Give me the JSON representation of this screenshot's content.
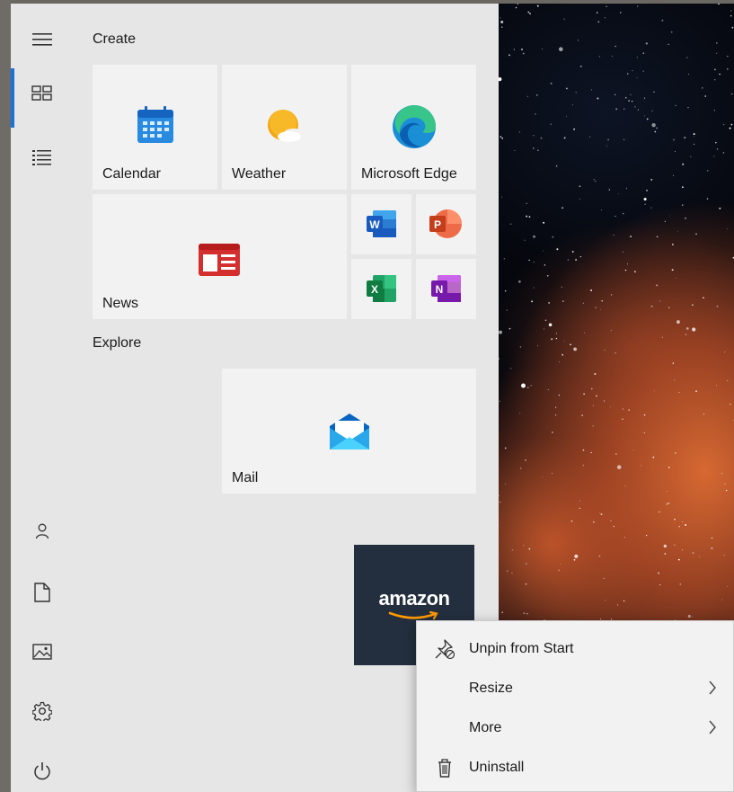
{
  "start_menu": {
    "rail": {
      "items": [
        {
          "icon": "hamburger-menu-icon"
        },
        {
          "icon": "tiles-icon",
          "active": true
        },
        {
          "icon": "all-apps-list-icon"
        },
        {
          "icon": "user-icon"
        },
        {
          "icon": "documents-icon"
        },
        {
          "icon": "pictures-icon"
        },
        {
          "icon": "settings-gear-icon"
        },
        {
          "icon": "power-icon"
        }
      ]
    },
    "groups": [
      {
        "title": "Create"
      },
      {
        "title": "Explore"
      }
    ],
    "tiles": {
      "calendar": {
        "label": "Calendar",
        "icon": "calendar-icon"
      },
      "weather": {
        "label": "Weather",
        "icon": "weather-icon"
      },
      "edge": {
        "label": "Microsoft Edge",
        "icon": "edge-icon"
      },
      "news": {
        "label": "News",
        "icon": "news-icon"
      },
      "word": {
        "letter": "W",
        "icon": "word-icon"
      },
      "powerpoint": {
        "letter": "P",
        "icon": "powerpoint-icon"
      },
      "excel": {
        "letter": "X",
        "icon": "excel-icon"
      },
      "onenote": {
        "letter": "N",
        "icon": "onenote-icon"
      },
      "mail": {
        "label": "Mail",
        "icon": "mail-icon"
      },
      "amazon": {
        "label": "amazon",
        "icon": "amazon-logo"
      }
    }
  },
  "context_menu": {
    "items": [
      {
        "label": "Unpin from Start",
        "icon": "unpin-icon",
        "submenu": false
      },
      {
        "label": "Resize",
        "icon": "",
        "submenu": true
      },
      {
        "label": "More",
        "icon": "",
        "submenu": true
      },
      {
        "label": "Uninstall",
        "icon": "trash-icon",
        "submenu": false
      }
    ]
  },
  "colors": {
    "accent": "#1a73d9",
    "start_bg": "#e6e6e6",
    "tile_bg": "#f2f2f2",
    "amazon_tile_bg": "#232f3e",
    "amazon_smile": "#ff9900"
  }
}
